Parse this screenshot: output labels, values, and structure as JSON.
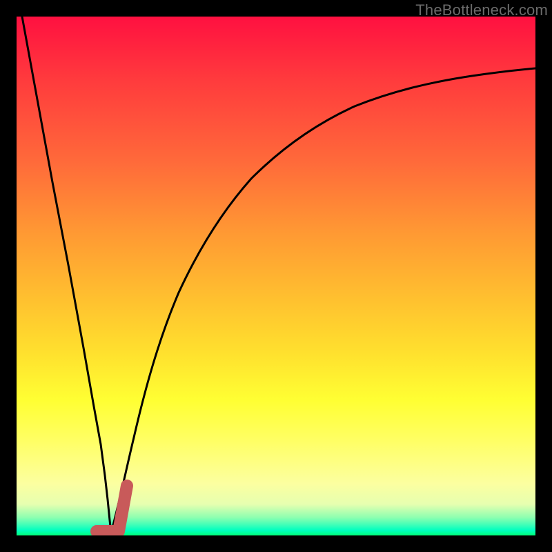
{
  "watermark": {
    "text": "TheBottleneck.com"
  },
  "colors": {
    "curve": "#000000",
    "marker": "#c85a5a",
    "frame": "#000000"
  },
  "chart_data": {
    "type": "line",
    "title": "",
    "xlabel": "",
    "ylabel": "",
    "xlim": [
      0,
      100
    ],
    "ylim": [
      0,
      100
    ],
    "grid": false,
    "legend": false,
    "annotations": [
      "TheBottleneck.com"
    ],
    "series": [
      {
        "name": "left-branch",
        "x": [
          0,
          3,
          6,
          9,
          12,
          14,
          15,
          15.5
        ],
        "y": [
          100,
          80,
          60,
          40,
          20,
          7,
          2,
          0
        ]
      },
      {
        "name": "right-branch",
        "x": [
          15.5,
          17,
          19,
          21,
          24,
          27,
          31,
          36,
          42,
          50,
          60,
          72,
          86,
          100
        ],
        "y": [
          0,
          6,
          14,
          22,
          32,
          41,
          50,
          58,
          65,
          72,
          78,
          83,
          86.5,
          89
        ]
      },
      {
        "name": "minimum-marker",
        "x": [
          13.5,
          15.5,
          15.5,
          18.5,
          18.5
        ],
        "y": [
          0.5,
          0.5,
          0.5,
          0.5,
          9
        ]
      }
    ]
  }
}
